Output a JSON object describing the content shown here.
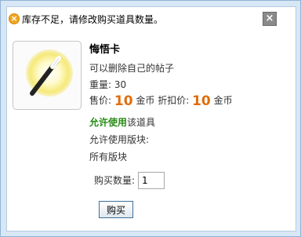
{
  "notice": {
    "icon": "warning-icon",
    "text": "库存不足，请修改购买道具数量。"
  },
  "close": {
    "icon": "close-icon",
    "label": "×"
  },
  "item": {
    "image": "magic-wand-icon",
    "name": "悔悟卡",
    "description": "可以删除自己的帖子",
    "weight_label": "重量: 30",
    "price_label": "售价:",
    "price_value": "10",
    "price_unit": "金币",
    "discount_label": "折扣价:",
    "discount_value": "10",
    "discount_unit": "金币",
    "allow_label": "允许使用",
    "allow_suffix": "该道具",
    "sections_label": "允许使用版块:",
    "sections_value": "所有版块"
  },
  "purchase": {
    "quantity_label": "购买数量:",
    "quantity_value": "1",
    "buy_label": "购买"
  },
  "colors": {
    "price": "#e06e0c",
    "allow": "#268c14",
    "frame": "#d8e7f5"
  }
}
